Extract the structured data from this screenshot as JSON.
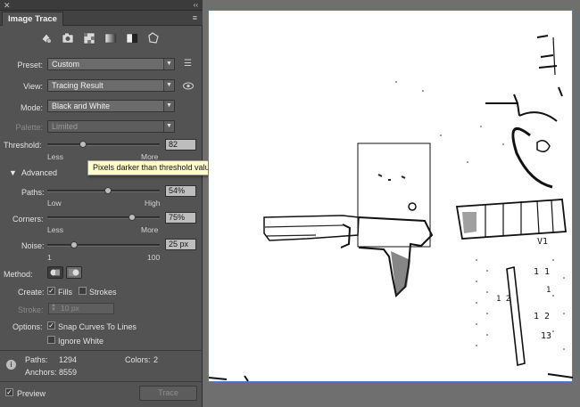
{
  "panel": {
    "close_glyph": "✕",
    "collapse_glyph": "‹‹",
    "tab_title": "Image Trace",
    "tab_menu_glyph": "≡",
    "preset_icons": [
      "auto-color-icon",
      "high-color-icon",
      "low-color-icon",
      "grayscale-icon",
      "black-and-white-icon",
      "outline-icon"
    ],
    "preset": {
      "label": "Preset:",
      "value": "Custom"
    },
    "view": {
      "label": "View:",
      "value": "Tracing Result"
    },
    "mode": {
      "label": "Mode:",
      "value": "Black and White"
    },
    "palette": {
      "label": "Palette:",
      "value": "Limited"
    },
    "threshold": {
      "label": "Threshold:",
      "value": "82",
      "level": 0.32,
      "min_label": "Less",
      "max_label": "More"
    },
    "advanced": {
      "label": "Advanced"
    },
    "paths": {
      "label": "Paths:",
      "value": "54%",
      "level": 0.54,
      "min_label": "Low",
      "max_label": "High"
    },
    "corners": {
      "label": "Corners:",
      "value": "75%",
      "level": 0.75,
      "min_label": "Less",
      "max_label": "More"
    },
    "noise": {
      "label": "Noise:",
      "value": "25 px",
      "level": 0.24,
      "min_label": "1",
      "max_label": "100"
    },
    "method": {
      "label": "Method:"
    },
    "create": {
      "label": "Create:",
      "fills_label": "Fills",
      "fills_checked": true,
      "strokes_label": "Strokes",
      "strokes_checked": false
    },
    "stroke": {
      "label": "Stroke:",
      "value": "10 px"
    },
    "options": {
      "label": "Options:",
      "snap_label": "Snap Curves To Lines",
      "snap_checked": true,
      "ignore_white_label": "Ignore White",
      "ignore_white_checked": false
    },
    "info_glyph": "i",
    "stats": {
      "paths_label": "Paths:",
      "paths_value": "1294",
      "colors_label": "Colors:",
      "colors_value": "2",
      "anchors_label": "Anchors:",
      "anchors_value": "8559"
    },
    "preview": {
      "label": "Preview",
      "checked": true
    },
    "trace_button": "Trace"
  },
  "tooltip": {
    "text": "Pixels darker than threshold value are converted to black"
  },
  "canvas": {
    "sketch_labels": [
      "V1",
      "1 1",
      "1 2",
      "13",
      "1 2",
      "1"
    ]
  },
  "colors": {
    "panel_bg": "#535353",
    "canvas_border": "#5b7bd5",
    "tooltip_bg": "#fffbc8"
  }
}
